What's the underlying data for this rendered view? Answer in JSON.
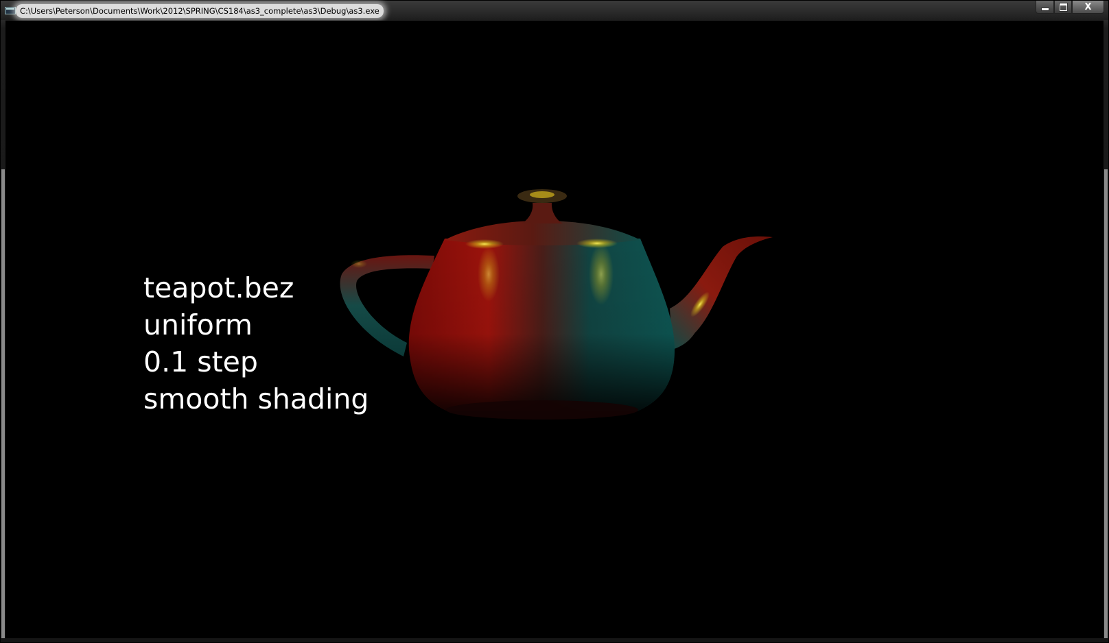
{
  "window": {
    "title": "C:\\Users\\Peterson\\Documents\\Work\\2012\\SPRING\\CS184\\as3_complete\\as3\\Debug\\as3.exe",
    "icon": "console-app-icon",
    "controls": {
      "minimize_icon": "minimize-icon",
      "maximize_icon": "maximize-icon",
      "close_label": "X"
    }
  },
  "scene": {
    "background": "#000000",
    "object": "teapot",
    "info_lines": [
      "teapot.bez",
      "uniform",
      "0.1 step",
      "smooth shading"
    ],
    "colors": {
      "warm": "#a8120c",
      "cool": "#0e5a55",
      "highlight": "#e8e21a",
      "text": "#ffffff"
    }
  }
}
